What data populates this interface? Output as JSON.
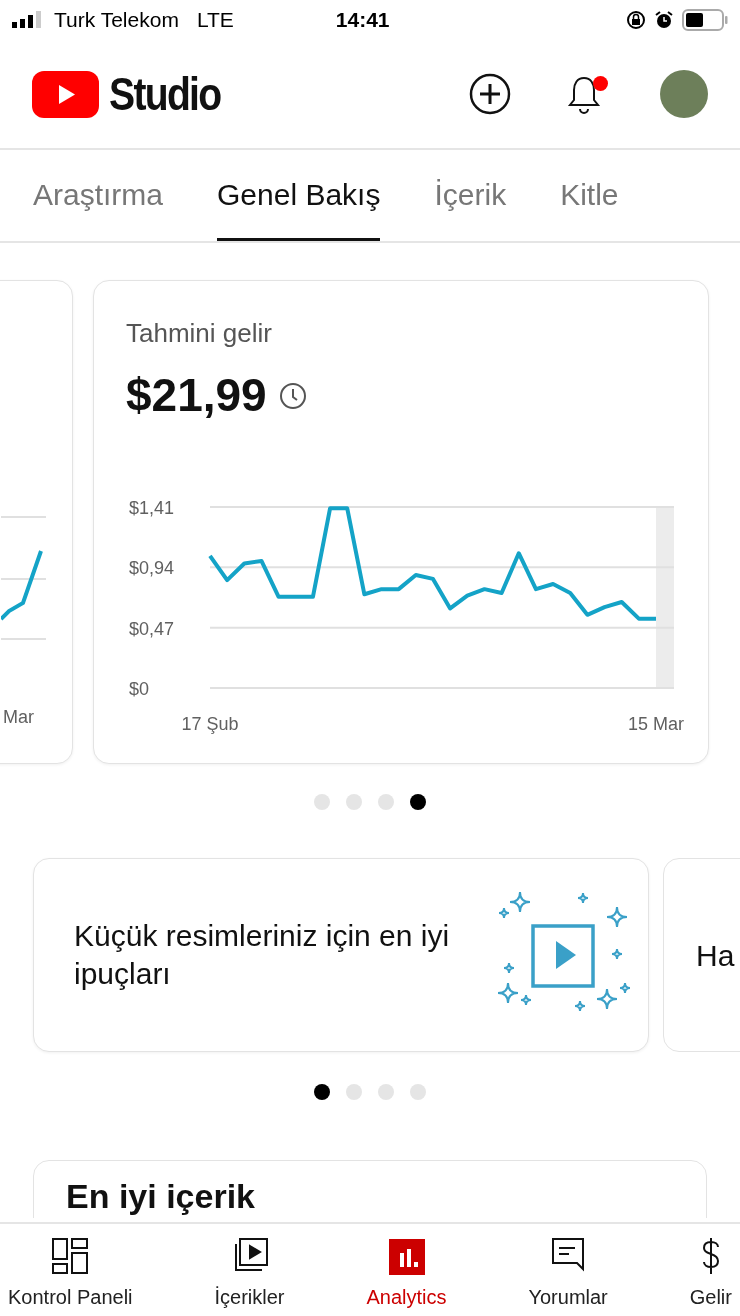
{
  "status_bar": {
    "carrier": "Turk Telekom",
    "network": "LTE",
    "time": "14:41"
  },
  "header": {
    "title": "Studio",
    "has_notification": true
  },
  "tabs": [
    {
      "label": "Araştırma",
      "selected": false
    },
    {
      "label": "Genel Bakış",
      "selected": true
    },
    {
      "label": "İçerik",
      "selected": false
    },
    {
      "label": "Kitle",
      "selected": false
    }
  ],
  "revenue_carousel": {
    "previous_card": {
      "axis_label": "Mar"
    },
    "card": {
      "title": "Tahmini gelir",
      "value": "$21,99",
      "chart_data": {
        "type": "line",
        "categories": [
          "17 Şub",
          null,
          null,
          null,
          null,
          null,
          null,
          null,
          null,
          null,
          null,
          null,
          null,
          null,
          null,
          null,
          null,
          null,
          null,
          null,
          null,
          null,
          null,
          null,
          null,
          null,
          "15 Mar"
        ],
        "ylim": [
          0,
          1.41
        ],
        "yticks": [
          {
            "value": 0,
            "label": "$0"
          },
          {
            "value": 0.47,
            "label": "$0,47"
          },
          {
            "value": 0.94,
            "label": "$0,94"
          },
          {
            "value": 1.41,
            "label": "$1,41"
          }
        ],
        "series": [
          {
            "color": "#14a3c7",
            "values": [
              1.03,
              0.84,
              0.97,
              0.99,
              0.71,
              0.71,
              0.71,
              1.4,
              1.4,
              0.73,
              0.77,
              0.77,
              0.88,
              0.85,
              0.62,
              0.72,
              0.77,
              0.74,
              1.05,
              0.77,
              0.81,
              0.74,
              0.57,
              0.63,
              0.67,
              0.54,
              0.54
            ]
          }
        ]
      }
    },
    "dots": [
      {
        "selected": false
      },
      {
        "selected": false
      },
      {
        "selected": false
      },
      {
        "selected": true
      }
    ]
  },
  "tips_carousel": {
    "card": {
      "text": "Küçük resimleriniz için en iyi ipuçları"
    },
    "next_card": {
      "text": "Ha"
    },
    "dots": [
      {
        "selected": true
      },
      {
        "selected": false
      },
      {
        "selected": false
      },
      {
        "selected": false
      }
    ]
  },
  "top_content": {
    "title": "En iyi içerik"
  },
  "bottom_nav": [
    {
      "kind": "dashboard",
      "label": "Kontrol Paneli",
      "selected": false
    },
    {
      "kind": "content",
      "label": "İçerikler",
      "selected": false
    },
    {
      "kind": "analytics",
      "label": "Analytics",
      "selected": true
    },
    {
      "kind": "comments",
      "label": "Yorumlar",
      "selected": false
    },
    {
      "kind": "earn",
      "label": "Gelir",
      "selected": false
    }
  ]
}
